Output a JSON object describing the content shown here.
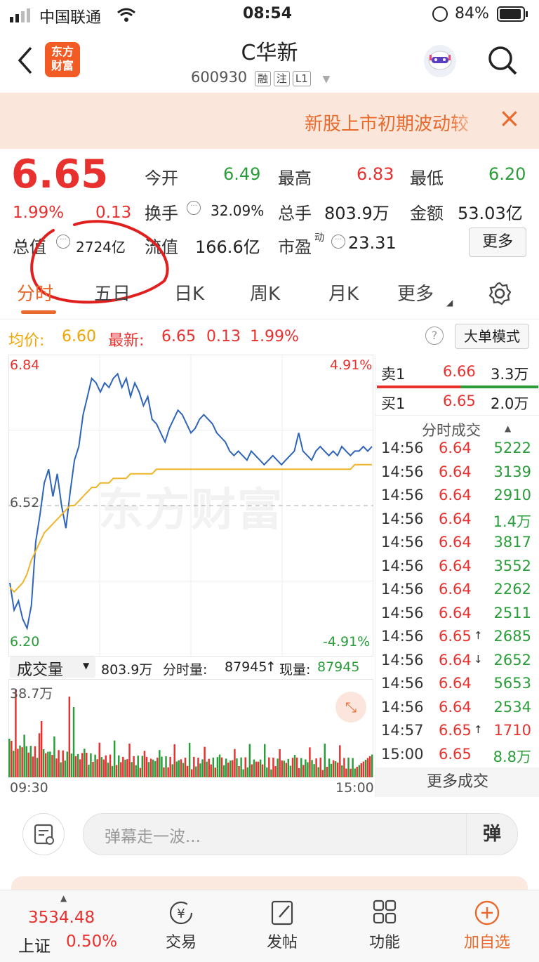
{
  "status": {
    "carrier": "中国联通",
    "time": "08:54",
    "battery": "84%"
  },
  "header": {
    "title": "C华新",
    "code": "600930",
    "tags": [
      "融",
      "注",
      "L1"
    ],
    "logo": "东方\n财富"
  },
  "notice": {
    "text": "新股上市初期波动较",
    "close": "×"
  },
  "quote": {
    "price": "6.65",
    "pct": "1.99%",
    "chg": "0.13",
    "open_label": "今开",
    "open": "6.49",
    "high_label": "最高",
    "high": "6.83",
    "low_label": "最低",
    "low": "6.20",
    "turnover_label": "换手",
    "turnover": "32.09%",
    "vol_label": "总手",
    "vol": "803.9万",
    "amount_label": "金额",
    "amount": "53.03亿",
    "mktcap_label": "总值",
    "mktcap": "2724亿",
    "float_label": "流值",
    "float": "166.6亿",
    "pe_label": "市盈",
    "pe_sup": "动",
    "pe": "23.31",
    "more": "更多"
  },
  "tabs": [
    {
      "label": "分时",
      "active": true
    },
    {
      "label": "五日"
    },
    {
      "label": "日K"
    },
    {
      "label": "周K"
    },
    {
      "label": "月K"
    },
    {
      "label": "更多"
    }
  ],
  "chart_info": {
    "avg_label": "均价:",
    "avg": "6.60",
    "latest_label": "最新:",
    "latest": "6.65",
    "latest_chg": "0.13",
    "latest_pct": "1.99%",
    "big_mode": "大单模式",
    "y_top": "6.84",
    "y_mid": "6.52",
    "y_bottom": "6.20",
    "pct_top": "4.91%",
    "pct_bottom": "-4.91%",
    "watermark": "东方财富"
  },
  "chart_data": {
    "type": "line",
    "ylim": [
      6.2,
      6.84
    ],
    "series": [
      {
        "name": "price",
        "color": "#2f64b8",
        "values": [
          6.35,
          6.29,
          6.31,
          6.27,
          6.25,
          6.3,
          6.44,
          6.5,
          6.57,
          6.6,
          6.54,
          6.59,
          6.52,
          6.47,
          6.55,
          6.62,
          6.65,
          6.72,
          6.76,
          6.8,
          6.79,
          6.77,
          6.79,
          6.78,
          6.8,
          6.81,
          6.78,
          6.8,
          6.76,
          6.79,
          6.77,
          6.74,
          6.76,
          6.71,
          6.7,
          6.68,
          6.66,
          6.69,
          6.71,
          6.73,
          6.72,
          6.7,
          6.68,
          6.69,
          6.71,
          6.72,
          6.71,
          6.7,
          6.68,
          6.67,
          6.66,
          6.64,
          6.63,
          6.64,
          6.63,
          6.62,
          6.64,
          6.63,
          6.62,
          6.61,
          6.62,
          6.63,
          6.62,
          6.61,
          6.62,
          6.63,
          6.64,
          6.68,
          6.64,
          6.63,
          6.62,
          6.64,
          6.65,
          6.64,
          6.63,
          6.64,
          6.63,
          6.65,
          6.64,
          6.63,
          6.64,
          6.64,
          6.65,
          6.64,
          6.65
        ]
      },
      {
        "name": "avg",
        "color": "#f0b429",
        "values": [
          6.34,
          6.33,
          6.34,
          6.35,
          6.37,
          6.4,
          6.42,
          6.44,
          6.46,
          6.47,
          6.48,
          6.49,
          6.5,
          6.51,
          6.52,
          6.52,
          6.53,
          6.54,
          6.55,
          6.56,
          6.56,
          6.57,
          6.57,
          6.57,
          6.58,
          6.58,
          6.58,
          6.58,
          6.59,
          6.59,
          6.59,
          6.59,
          6.59,
          6.59,
          6.6,
          6.6,
          6.6,
          6.6,
          6.6,
          6.6,
          6.6,
          6.6,
          6.6,
          6.6,
          6.6,
          6.6,
          6.6,
          6.6,
          6.6,
          6.6,
          6.6,
          6.6,
          6.6,
          6.6,
          6.6,
          6.6,
          6.6,
          6.6,
          6.6,
          6.6,
          6.6,
          6.6,
          6.6,
          6.6,
          6.6,
          6.6,
          6.6,
          6.6,
          6.6,
          6.6,
          6.6,
          6.6,
          6.6,
          6.6,
          6.6,
          6.6,
          6.6,
          6.6,
          6.6,
          6.6,
          6.61,
          6.61,
          6.61,
          6.61,
          6.61
        ]
      }
    ]
  },
  "orderbook": {
    "sell": {
      "label": "卖1",
      "price": "6.66",
      "qty": "3.3万"
    },
    "buy": {
      "label": "买1",
      "price": "6.65",
      "qty": "2.0万"
    },
    "title": "分时成交",
    "trades": [
      {
        "t": "14:56",
        "p": "6.64",
        "q": "5222",
        "arrow": ""
      },
      {
        "t": "14:56",
        "p": "6.64",
        "q": "3139",
        "arrow": ""
      },
      {
        "t": "14:56",
        "p": "6.64",
        "q": "2910",
        "arrow": ""
      },
      {
        "t": "14:56",
        "p": "6.64",
        "q": "1.4万",
        "arrow": ""
      },
      {
        "t": "14:56",
        "p": "6.64",
        "q": "3817",
        "arrow": ""
      },
      {
        "t": "14:56",
        "p": "6.64",
        "q": "3552",
        "arrow": ""
      },
      {
        "t": "14:56",
        "p": "6.64",
        "q": "2262",
        "arrow": ""
      },
      {
        "t": "14:56",
        "p": "6.64",
        "q": "2511",
        "arrow": ""
      },
      {
        "t": "14:56",
        "p": "6.65",
        "q": "2685",
        "arrow": "↑"
      },
      {
        "t": "14:56",
        "p": "6.64",
        "q": "2652",
        "arrow": "↓"
      },
      {
        "t": "14:56",
        "p": "6.64",
        "q": "5653",
        "arrow": ""
      },
      {
        "t": "14:56",
        "p": "6.64",
        "q": "2534",
        "arrow": ""
      },
      {
        "t": "14:57",
        "p": "6.65",
        "q": "1710",
        "arrow": "↑"
      },
      {
        "t": "15:00",
        "p": "6.65",
        "q": "8.8万",
        "arrow": ""
      }
    ],
    "more": "更多成交"
  },
  "volume": {
    "label": "成交量",
    "total": "803.9万",
    "fen_label": "分时量:",
    "fen": "87945",
    "xian_label": "现量:",
    "xian": "87945",
    "max": "38.7万",
    "t_start": "09:30",
    "t_end": "15:00"
  },
  "danmu": {
    "placeholder": "弹幕走一波...",
    "send": "弹"
  },
  "bottom": {
    "index_value": "3534.48",
    "index_name": "上证",
    "index_pct": "0.50%",
    "nav": [
      "交易",
      "发帖",
      "功能",
      "加自选"
    ]
  }
}
